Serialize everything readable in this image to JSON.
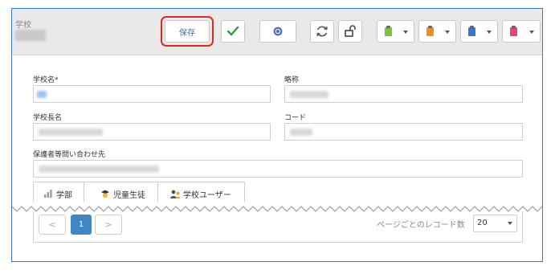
{
  "header": {
    "title": "学校",
    "save_label": "保存",
    "accent_color": "#3f6ea8",
    "highlight_color": "#dd2a25",
    "buttons": [
      {
        "name": "confirm",
        "icon": "check-icon"
      },
      {
        "name": "help",
        "icon": "help-icon"
      },
      {
        "name": "refresh",
        "icon": "refresh-icon"
      },
      {
        "name": "unlock",
        "icon": "unlock-icon"
      }
    ],
    "clipboard_dropdowns": [
      {
        "icon": "clipboard-green-icon",
        "color": "#7cc043"
      },
      {
        "icon": "clipboard-orange-icon",
        "color": "#e8902f"
      },
      {
        "icon": "clipboard-blue-icon",
        "color": "#3a78c4"
      },
      {
        "icon": "clipboard-pink-icon",
        "color": "#e0457e"
      }
    ]
  },
  "form": {
    "school_name_label": "学校名*",
    "abbreviation_label": "略称",
    "principal_name_label": "学校長名",
    "code_label": "コード",
    "guardian_contact_label": "保護者等問い合わせ先"
  },
  "tabs": [
    {
      "label": "学部",
      "icon": "bar-chart-icon"
    },
    {
      "label": "児童生徒",
      "icon": "student-icon"
    },
    {
      "label": "学校ユーザー",
      "icon": "users-icon"
    }
  ],
  "pager": {
    "prev": "<",
    "current_page": "1",
    "next": ">",
    "page_size_label": "ページごとのレコード数",
    "page_size": "20"
  }
}
